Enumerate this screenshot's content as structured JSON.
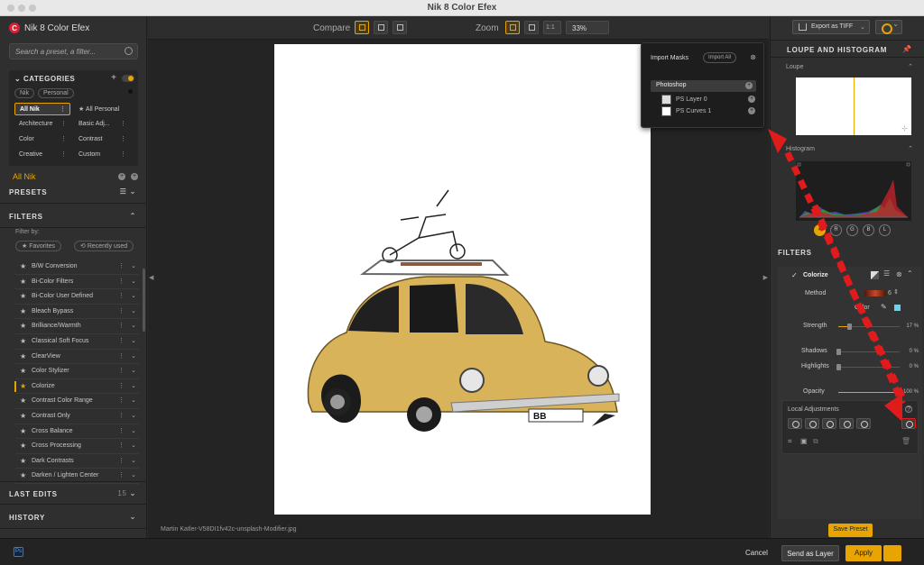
{
  "window": {
    "title": "Nik 8 Color Efex"
  },
  "app": {
    "name": "Nik 8 Color Efex",
    "logo_letter": "C"
  },
  "search": {
    "placeholder": "Search a preset, a filter..."
  },
  "categories": {
    "title": "CATEGORIES",
    "chips": [
      "Nik",
      "Personal"
    ],
    "items": [
      "All Nik",
      "All Personal",
      "Architecture",
      "Basic Adj...",
      "Color",
      "Contrast",
      "Creative",
      "Custom"
    ],
    "selected": "All Nik"
  },
  "current_category": "All Nik",
  "sections": {
    "presets": "PRESETS",
    "filters": "FILTERS",
    "last_edits": "LAST EDITS",
    "last_edits_count": "15",
    "history": "HISTORY"
  },
  "filter_by": {
    "label": "Filter by:",
    "favorites": "Favorites",
    "recently_used": "Recently used"
  },
  "filters_list": [
    "B/W Conversion",
    "Bi-Color Filters",
    "Bi-Color User Defined",
    "Bleach Bypass",
    "Brilliance/Warmth",
    "Classical Soft Focus",
    "ClearView",
    "Color Stylizer",
    "Colorize",
    "Contrast Color Range",
    "Contrast Only",
    "Cross Balance",
    "Cross Processing",
    "Dark Contrasts",
    "Darken / Lighten Center"
  ],
  "active_filter": "Colorize",
  "toolbar": {
    "compare_label": "Compare",
    "zoom_label": "Zoom",
    "zoom_value": "33%",
    "one_to_one": "1:1"
  },
  "file": {
    "name": "Martin Katler-V58DI1fv42c-unsplash-Modifier.jpg"
  },
  "masks": {
    "title": "Import Masks",
    "import_all": "Import All",
    "group": "Photoshop",
    "layers": [
      "PS Layer 0",
      "PS Curves 1"
    ]
  },
  "right_panel": {
    "export_label": "Export as TIFF",
    "loupe_histogram_title": "LOUPE AND HISTOGRAM",
    "loupe_label": "Loupe",
    "histogram_label": "Histogram",
    "channels": [
      "R",
      "G",
      "B",
      "L"
    ],
    "filters_title": "FILTERS"
  },
  "colorize": {
    "title": "Colorize",
    "method_label": "Method",
    "method_value": "6",
    "color_label": "Color",
    "color_hex": "#6fd0e6",
    "sliders": [
      {
        "label": "Strength",
        "value": "17 %",
        "fraction": 0.17
      },
      {
        "label": "Shadows",
        "value": "0 %",
        "fraction": 0.0
      },
      {
        "label": "Highlights",
        "value": "0 %",
        "fraction": 0.0
      },
      {
        "label": "Opacity",
        "value": "100 %",
        "fraction": 1.0
      }
    ]
  },
  "local_adjustments": {
    "title": "Local Adjustments",
    "help": "?"
  },
  "save_preset": "Save Preset",
  "bottom": {
    "host_icon": "Ps",
    "cancel": "Cancel",
    "send_as_layer": "Send as Layer",
    "apply": "Apply"
  },
  "canvas_plate": "BB",
  "colors": {
    "accent": "#e8a400",
    "annotation_arrow": "#e01b1b"
  }
}
